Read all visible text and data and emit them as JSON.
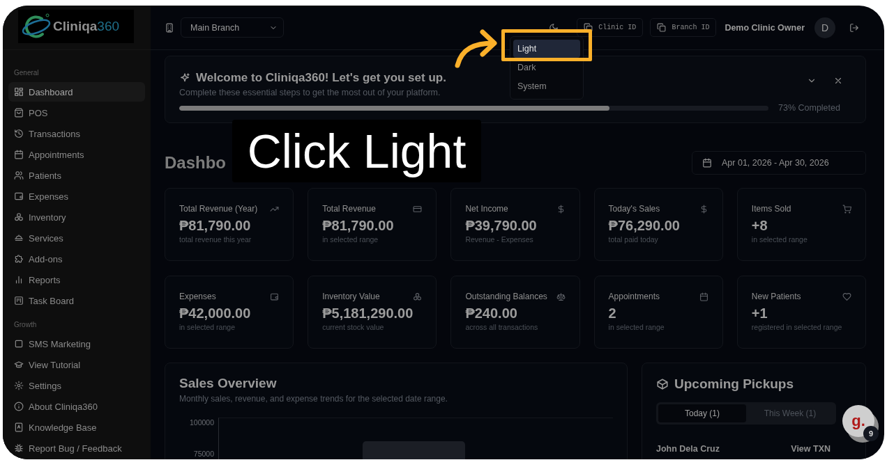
{
  "sidebar": {
    "logo_text": [
      "Cliniqa",
      "360"
    ],
    "sections": [
      {
        "heading": "General",
        "items": [
          {
            "label": "Dashboard",
            "selected": true
          },
          {
            "label": "POS",
            "selected": false
          },
          {
            "label": "Transactions",
            "selected": false
          },
          {
            "label": "Appointments",
            "selected": false
          },
          {
            "label": "Patients",
            "selected": false
          },
          {
            "label": "Expenses",
            "selected": false
          },
          {
            "label": "Inventory",
            "selected": false
          },
          {
            "label": "Services",
            "selected": false
          },
          {
            "label": "Add-ons",
            "selected": false
          },
          {
            "label": "Reports",
            "selected": false
          },
          {
            "label": "Task Board",
            "selected": false
          }
        ]
      },
      {
        "heading": "Growth",
        "items": [
          {
            "label": "SMS Marketing",
            "selected": false
          }
        ]
      }
    ],
    "footer_items": [
      "View Tutorial",
      "Settings",
      "About Cliniqa360",
      "Knowledge Base",
      "Report Bug / Feedback"
    ]
  },
  "header": {
    "branch_select": {
      "value": "Main Branch"
    },
    "id_buttons": [
      "Clinic ID",
      "Branch ID"
    ],
    "user_name": "Demo Clinic Owner",
    "avatar_initial": "D"
  },
  "theme_menu": {
    "options": [
      {
        "label": "Light",
        "selected": true
      },
      {
        "label": "Dark",
        "selected": false
      },
      {
        "label": "System",
        "selected": false
      }
    ]
  },
  "welcome": {
    "title": "Welcome to Cliniqa360! Let's get you set up.",
    "subtitle": "Complete these essential steps to get the most out of your platform.",
    "progress": {
      "level": 0.73
    },
    "progress_text": "73% Completed"
  },
  "page_title": "Dashbo",
  "date_range": "Apr 01, 2026 - Apr 30, 2026",
  "stats": [
    {
      "title": "Total Revenue (Year)",
      "value": "₱81,790.00",
      "note": "total revenue this year"
    },
    {
      "title": "Total Revenue",
      "value": "₱81,790.00",
      "note": "in selected range"
    },
    {
      "title": "Net Income",
      "value": "₱39,790.00",
      "note": "Revenue - Expenses"
    },
    {
      "title": "Today's Sales",
      "value": "₱76,290.00",
      "note": "total paid today"
    },
    {
      "title": "Items Sold",
      "value": "+8",
      "note": "in selected range"
    },
    {
      "title": "Expenses",
      "value": "₱42,000.00",
      "note": "in selected range"
    },
    {
      "title": "Inventory Value",
      "value": "₱5,181,290.00",
      "note": "current stock value"
    },
    {
      "title": "Outstanding Balances",
      "value": "₱240.00",
      "note": "across all transactions"
    },
    {
      "title": "Appointments",
      "value": "2",
      "note": "in selected range"
    },
    {
      "title": "New Patients",
      "value": "+1",
      "note": "registered in selected range"
    }
  ],
  "sales_overview": {
    "title": "Sales Overview",
    "subtitle": "Monthly sales, revenue, and expense trends for the selected date range.",
    "y_axis_labels": [
      "100000",
      "75000"
    ]
  },
  "pickups": {
    "title": "Upcoming Pickups",
    "tabs": [
      {
        "label": "Today (1)",
        "selected": true
      },
      {
        "label": "This Week (1)",
        "selected": false
      }
    ],
    "rows": [
      {
        "name": "John Dela Cruz",
        "action": "View TXN"
      }
    ]
  },
  "chat_widget": {
    "logo_text": "g.",
    "badge": "9"
  },
  "annotation": {
    "caption": "Click Light"
  }
}
